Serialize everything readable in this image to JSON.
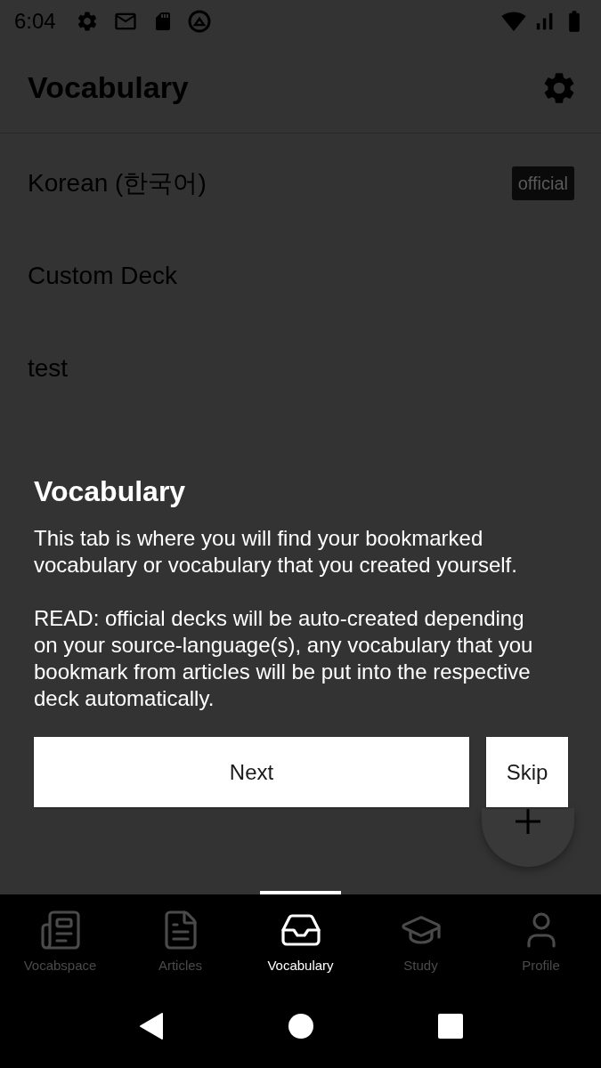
{
  "status_bar": {
    "time": "6:04"
  },
  "app_bar": {
    "title": "Vocabulary"
  },
  "decks": [
    {
      "name": "Korean (한국어)",
      "badge": "official"
    },
    {
      "name": "Custom Deck"
    },
    {
      "name": "test"
    }
  ],
  "coach_mark": {
    "title": "Vocabulary",
    "paragraphs": [
      "This tab is where you will find your bookmarked vocabulary or vocabulary that you created yourself.",
      "READ: official decks will be auto-created depending on your source-language(s), any vocabulary that you bookmark from articles will be put into the respective deck automatically."
    ],
    "buttons": [
      "Next",
      "Skip"
    ]
  },
  "bottom_nav": [
    {
      "label": "Vocabspace",
      "kind": "newspaper",
      "selected": false
    },
    {
      "label": "Articles",
      "kind": "document",
      "selected": false
    },
    {
      "label": "Vocabulary",
      "kind": "inbox",
      "selected": true
    },
    {
      "label": "Study",
      "kind": "cap",
      "selected": false
    },
    {
      "label": "Profile",
      "kind": "person",
      "selected": false
    }
  ]
}
